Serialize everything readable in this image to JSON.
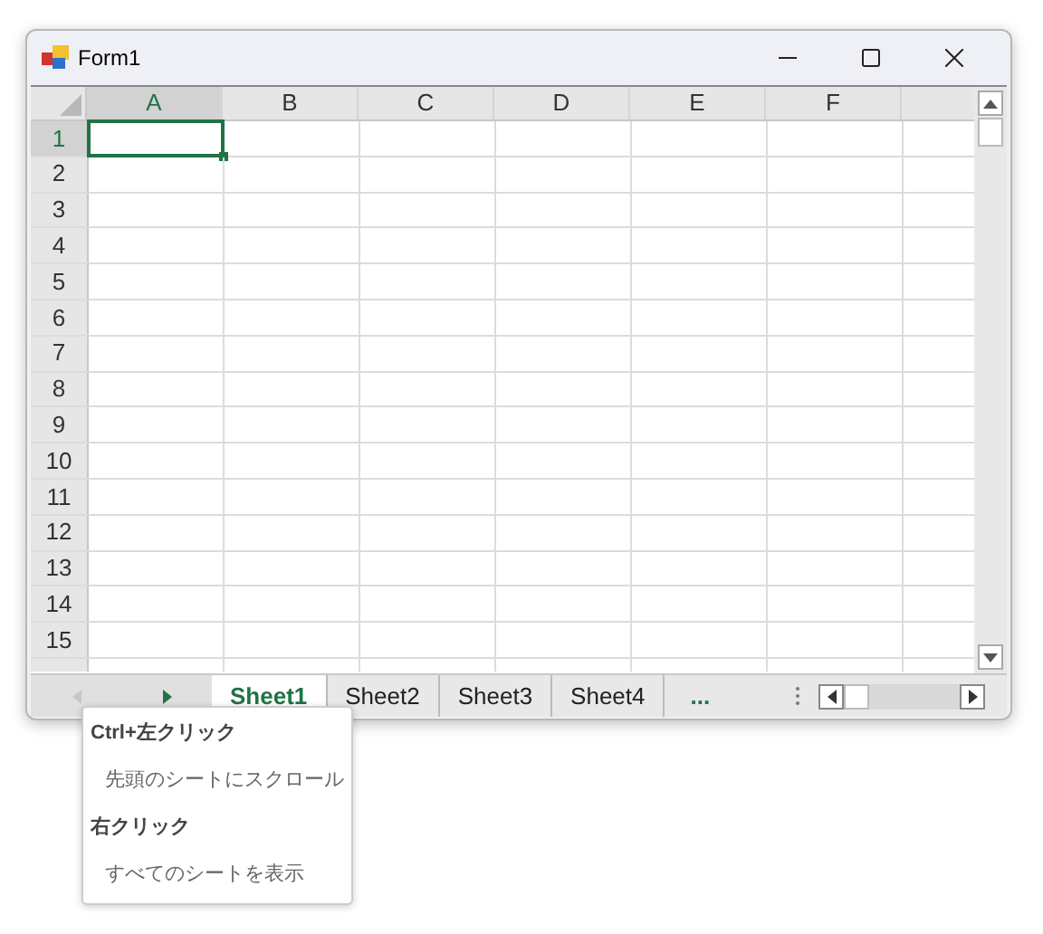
{
  "window": {
    "title": "Form1"
  },
  "columns": [
    {
      "label": "A",
      "selected": true
    },
    {
      "label": "B",
      "selected": false
    },
    {
      "label": "C",
      "selected": false
    },
    {
      "label": "D",
      "selected": false
    },
    {
      "label": "E",
      "selected": false
    },
    {
      "label": "F",
      "selected": false
    }
  ],
  "rows": [
    {
      "label": "1",
      "selected": true
    },
    {
      "label": "2",
      "selected": false
    },
    {
      "label": "3",
      "selected": false
    },
    {
      "label": "4",
      "selected": false
    },
    {
      "label": "5",
      "selected": false
    },
    {
      "label": "6",
      "selected": false
    },
    {
      "label": "7",
      "selected": false
    },
    {
      "label": "8",
      "selected": false
    },
    {
      "label": "9",
      "selected": false
    },
    {
      "label": "10",
      "selected": false
    },
    {
      "label": "11",
      "selected": false
    },
    {
      "label": "12",
      "selected": false
    },
    {
      "label": "13",
      "selected": false
    },
    {
      "label": "14",
      "selected": false
    },
    {
      "label": "15",
      "selected": false
    }
  ],
  "nav_buttons": [
    {
      "kind": "left",
      "disabled": true
    },
    {
      "kind": "right",
      "disabled": false
    }
  ],
  "sheet_tabs": [
    {
      "label": "Sheet1",
      "selected": true
    },
    {
      "label": "Sheet2",
      "selected": false
    },
    {
      "label": "Sheet3",
      "selected": false
    },
    {
      "label": "Sheet4",
      "selected": false
    }
  ],
  "more_tabs": "...",
  "tooltip": {
    "lines": [
      {
        "kind": "heading",
        "text": "Ctrl+左クリック"
      },
      {
        "kind": "detail",
        "text": "先頭のシートにスクロール"
      },
      {
        "kind": "heading",
        "text": "右クリック"
      },
      {
        "kind": "detail",
        "text": "すべてのシートを表示"
      }
    ]
  }
}
